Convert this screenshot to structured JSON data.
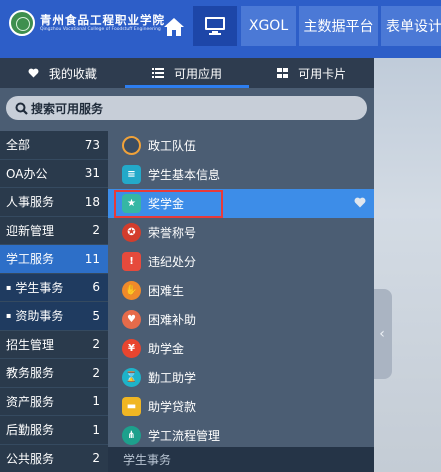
{
  "header": {
    "logo_cn": "青州食品工程职业学院",
    "logo_en": "Qingzhou Vocational College of Foodstuff Engineering",
    "nav_tabs": [
      "XGOL",
      "主数据平台",
      "表单设计"
    ]
  },
  "panel_tabs": [
    {
      "label": "我的收藏",
      "icon": "heart-icon"
    },
    {
      "label": "可用应用",
      "icon": "list-icon"
    },
    {
      "label": "可用卡片",
      "icon": "grid-icon"
    }
  ],
  "search": {
    "placeholder": "搜索可用服务"
  },
  "categories": [
    {
      "label": "全部",
      "count": "73"
    },
    {
      "label": "OA办公",
      "count": "31"
    },
    {
      "label": "人事服务",
      "count": "18"
    },
    {
      "label": "迎新管理",
      "count": "2"
    },
    {
      "label": "学工服务",
      "count": "11"
    },
    {
      "label": "学生事务",
      "count": "6"
    },
    {
      "label": "资助事务",
      "count": "5"
    },
    {
      "label": "招生管理",
      "count": "2"
    },
    {
      "label": "教务服务",
      "count": "2"
    },
    {
      "label": "资产服务",
      "count": "1"
    },
    {
      "label": "后勤服务",
      "count": "1"
    },
    {
      "label": "公共服务",
      "count": "2"
    }
  ],
  "apps": [
    {
      "label": "政工队伍",
      "icon": "team-icon",
      "color": "#3b4d63"
    },
    {
      "label": "学生基本信息",
      "icon": "student-card-icon",
      "color": "#23a9c9"
    },
    {
      "label": "奖学金",
      "icon": "award-icon",
      "color": "#35b7a4"
    },
    {
      "label": "荣誉称号",
      "icon": "medal-icon",
      "color": "#d33d2c"
    },
    {
      "label": "违纪处分",
      "icon": "warning-icon",
      "color": "#e64a3c"
    },
    {
      "label": "困难生",
      "icon": "hand-icon",
      "color": "#f08a2a"
    },
    {
      "label": "困难补助",
      "icon": "subsidy-icon",
      "color": "#e66b4a"
    },
    {
      "label": "助学金",
      "icon": "money-icon",
      "color": "#e8452f"
    },
    {
      "label": "勤工助学",
      "icon": "hourglass-icon",
      "color": "#1eb3c9"
    },
    {
      "label": "助学贷款",
      "icon": "loan-icon",
      "color": "#f0b623"
    },
    {
      "label": "学工流程管理",
      "icon": "flow-icon",
      "color": "#1da08c"
    }
  ],
  "section_footer": "学生事务",
  "colors": {
    "topbar": "#2d5ec8",
    "active_blue": "#2d6fc8",
    "highlight_red": "#e83a3a"
  }
}
